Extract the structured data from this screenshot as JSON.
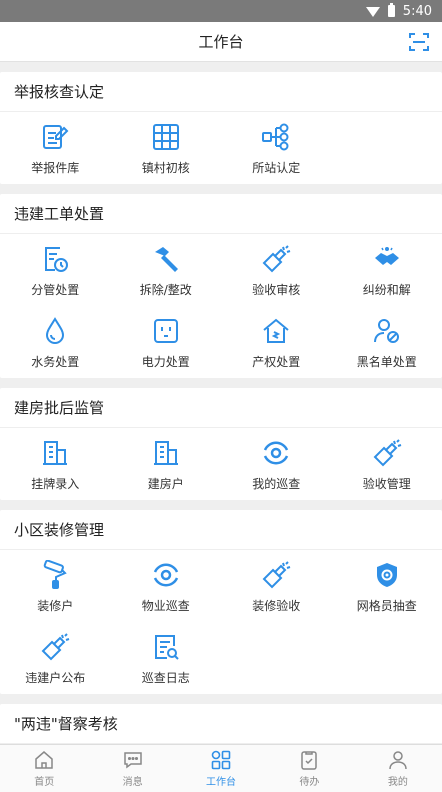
{
  "status": {
    "time": "5:40"
  },
  "header": {
    "title": "工作台",
    "scan_icon": "scan-icon"
  },
  "colors": {
    "accent": "#2f8fe6",
    "nav_inactive": "#888888"
  },
  "sections": [
    {
      "title": "举报核查认定",
      "items": [
        {
          "label": "举报件库",
          "icon": "edit-doc-icon"
        },
        {
          "label": "镇村初核",
          "icon": "grid-icon"
        },
        {
          "label": "所站认定",
          "icon": "org-tree-icon"
        }
      ]
    },
    {
      "title": "违建工单处置",
      "items": [
        {
          "label": "分管处置",
          "icon": "doc-clock-icon"
        },
        {
          "label": "拆除/整改",
          "icon": "hammer-icon"
        },
        {
          "label": "验收审核",
          "icon": "flashlight-icon"
        },
        {
          "label": "纠纷和解",
          "icon": "handshake-icon"
        },
        {
          "label": "水务处置",
          "icon": "water-drop-icon"
        },
        {
          "label": "电力处置",
          "icon": "power-socket-icon"
        },
        {
          "label": "产权处置",
          "icon": "house-icon"
        },
        {
          "label": "黑名单处置",
          "icon": "user-ban-icon"
        }
      ]
    },
    {
      "title": "建房批后监管",
      "items": [
        {
          "label": "挂牌录入",
          "icon": "building-icon"
        },
        {
          "label": "建房户",
          "icon": "building-icon"
        },
        {
          "label": "我的巡查",
          "icon": "eye-cycle-icon"
        },
        {
          "label": "验收管理",
          "icon": "flashlight-icon"
        }
      ]
    },
    {
      "title": "小区装修管理",
      "items": [
        {
          "label": "装修户",
          "icon": "paint-roller-icon"
        },
        {
          "label": "物业巡查",
          "icon": "eye-cycle-icon"
        },
        {
          "label": "装修验收",
          "icon": "flashlight-icon"
        },
        {
          "label": "网格员抽查",
          "icon": "shield-eye-icon"
        },
        {
          "label": "违建户公布",
          "icon": "flashlight-icon"
        },
        {
          "label": "巡查日志",
          "icon": "log-search-icon"
        }
      ]
    },
    {
      "title": "\"两违\"督察考核",
      "items": []
    }
  ],
  "nav": [
    {
      "label": "首页",
      "icon": "home-icon"
    },
    {
      "label": "消息",
      "icon": "message-icon"
    },
    {
      "label": "工作台",
      "icon": "workbench-icon",
      "active": true
    },
    {
      "label": "待办",
      "icon": "clipboard-icon"
    },
    {
      "label": "我的",
      "icon": "user-icon"
    }
  ]
}
